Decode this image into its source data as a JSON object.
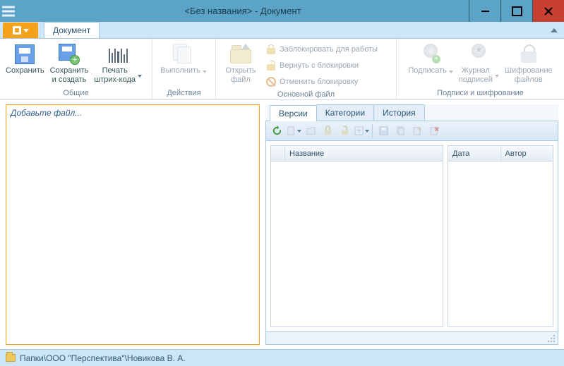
{
  "window": {
    "title": "<Без названия> - Документ"
  },
  "ribbon": {
    "tab": "Документ",
    "groups": {
      "common": {
        "label": "Общие",
        "save": "Сохранить",
        "save_create": "Сохранить\nи создать",
        "barcode": "Печать\nштрих-кода"
      },
      "actions": {
        "label": "Действия",
        "execute": "Выполнить"
      },
      "mainfile": {
        "label": "Основной файл",
        "open": "Открыть\nфайл",
        "lock": "Заблокировать для работы",
        "unlock": "Вернуть с блокировки",
        "cancel": "Отменить блокировку"
      },
      "sign": {
        "label": "Подписи и шифрование",
        "sign": "Подписать",
        "journal": "Журнал\nподписей",
        "encrypt": "Шифрование\nфайлов"
      }
    }
  },
  "left": {
    "placeholder": "Добавьте файл..."
  },
  "right": {
    "tabs": {
      "versions": "Версии",
      "categories": "Категории",
      "history": "История"
    },
    "columns": {
      "name": "Название",
      "date": "Дата",
      "author": "Автор"
    }
  },
  "status": {
    "path": "Папки\\ООО \"Перспектива\"\\Новикова В. А."
  }
}
